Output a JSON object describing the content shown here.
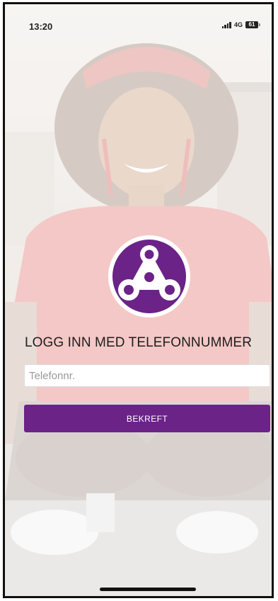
{
  "status_bar": {
    "time": "13:20",
    "network": "4G",
    "battery": "61"
  },
  "login": {
    "title": "LOGG INN MED TELEFONNUMMER",
    "phone_placeholder": "Telefonnr.",
    "phone_value": "",
    "confirm_label": "BEKREFT"
  },
  "colors": {
    "accent": "#6b2388",
    "logo_bg": "#6b2388",
    "logo_ring": "#ffffff",
    "input_bg": "#ffffff",
    "title_text": "#1e1e1e"
  },
  "icons": {
    "logo": "three-dot-triangle-logo-icon",
    "signal": "signal-bars-icon",
    "battery": "battery-icon"
  }
}
